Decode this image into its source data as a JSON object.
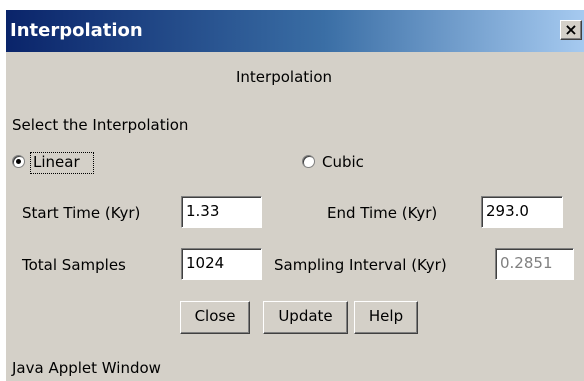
{
  "window": {
    "title": "Interpolation",
    "close_glyph": "×",
    "footer": "Java Applet Window"
  },
  "dialog": {
    "heading": "Interpolation",
    "select_label": "Select the Interpolation",
    "options": [
      {
        "label": "Linear",
        "selected": true
      },
      {
        "label": "Cubic",
        "selected": false
      }
    ]
  },
  "fields": {
    "start_time": {
      "label": "Start Time (Kyr)",
      "value": "1.33"
    },
    "end_time": {
      "label": "End Time (Kyr)",
      "value": "293.0"
    },
    "total_samples": {
      "label": "Total Samples",
      "value": "1024"
    },
    "sampling_interval": {
      "label": "Sampling Interval (Kyr)",
      "value": "0.2851",
      "editable": false
    }
  },
  "buttons": {
    "close": "Close",
    "update": "Update",
    "help": "Help"
  },
  "colors": {
    "title_gradient_start": "#0a246a",
    "title_gradient_end": "#a6caf0",
    "window_background": "#d4d0c8"
  },
  "icons": {
    "close": "close-icon"
  }
}
